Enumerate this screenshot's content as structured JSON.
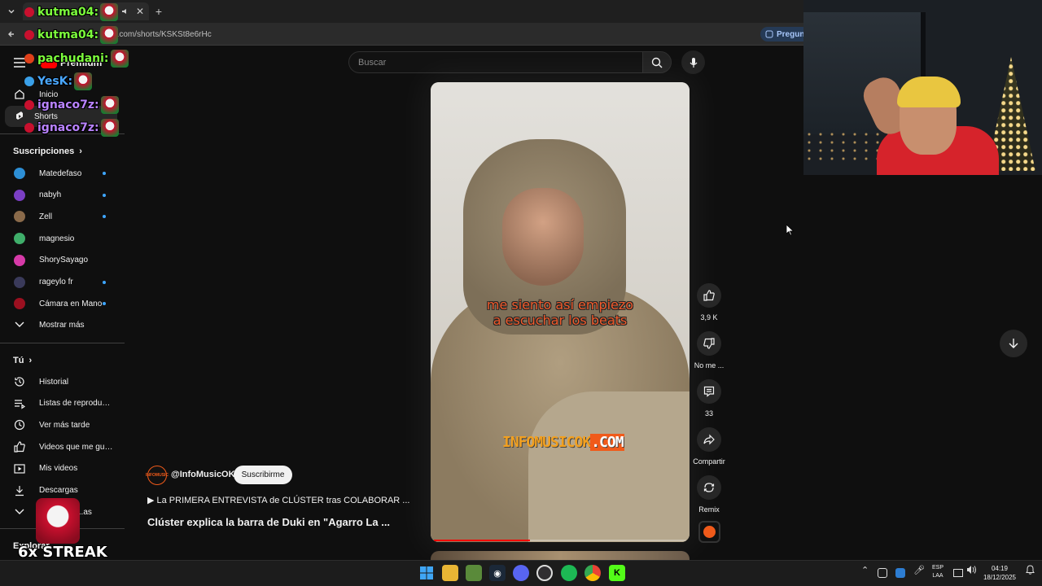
{
  "browser": {
    "tab_title": "",
    "url": "...com/shorts/KSKSt8e6rHc",
    "gemini_label": "Preguntar"
  },
  "youtube": {
    "premium_label": "Premium",
    "nav": {
      "inicio": "Inicio",
      "shorts": "Shorts"
    },
    "subscriptions_title": "Suscripciones",
    "subscriptions": [
      {
        "name": "Matedefaso",
        "color": "#2d8fd5",
        "dot": true
      },
      {
        "name": "nabyh",
        "color": "#7b3fc4",
        "dot": true
      },
      {
        "name": "Zell",
        "color": "#8a6a4a",
        "dot": true
      },
      {
        "name": "magnesio",
        "color": "#3fae6a",
        "dot": false
      },
      {
        "name": "ShorySayago",
        "color": "#d63aa8",
        "dot": false
      },
      {
        "name": "rageylo fr",
        "color": "#3a3a5a",
        "dot": true
      },
      {
        "name": "Cámara en Mano",
        "color": "#9b1020",
        "dot": true
      }
    ],
    "show_more": "Mostrar más",
    "you_title": "Tú",
    "you_items": [
      {
        "label": "Historial",
        "icon": "history-icon"
      },
      {
        "label": "Listas de reproducc...",
        "icon": "playlist-icon"
      },
      {
        "label": "Ver más tarde",
        "icon": "clock-icon"
      },
      {
        "label": "Videos que me gus...",
        "icon": "thumb-up-icon"
      },
      {
        "label": "Mis videos",
        "icon": "play-box-icon"
      },
      {
        "label": "Descargas",
        "icon": "download-icon"
      }
    ],
    "you_more_partial": "...as",
    "explore_title": "Explorar",
    "search_placeholder": "Buscar",
    "short": {
      "caption_line1": "me siento así empiezo",
      "caption_line2": "a escuchar los beats",
      "watermark_main": "INFOMUSICOK",
      "watermark_tld": ".COM",
      "progress": 0.38,
      "channel_handle": "@InfoMusicOK",
      "channel_avatar_text": "INFOMUSIC",
      "subscribe_label": "Suscribirme",
      "playlist_text": "▶  La PRIMERA ENTREVISTA de CLÚSTER tras COLABORAR ...",
      "title": "Clúster explica la barra de Duki en \"Agarro La ..."
    },
    "actions": {
      "likes": "3,9 K",
      "dislike_label": "No me ...",
      "comments": "33",
      "share_label": "Compartir",
      "remix_label": "Remix"
    }
  },
  "stream_overlay": {
    "chat": [
      {
        "user": "kutma04:",
        "color": "#7cfc3c",
        "badge": "#c8102e"
      },
      {
        "user": "kutma04:",
        "color": "#7cfc3c",
        "badge": "#c8102e"
      },
      {
        "user": "pachudani:",
        "color": "#7cfc3c",
        "badge": "#e0401a"
      },
      {
        "user": "YesK:",
        "color": "#4aa8ff",
        "badge": "#3aa0e8"
      },
      {
        "user": "ignaco7z:",
        "color": "#b983ff",
        "badge": "#c8102e"
      },
      {
        "user": "ignaco7z:",
        "color": "#b983ff",
        "badge": "#c8102e"
      }
    ],
    "streak": "6x STREAK"
  },
  "taskbar": {
    "lang_line1": "ESP",
    "lang_line2": "LAA",
    "time": "04:19",
    "date": "18/12/2025",
    "apps": [
      "windows-start-icon",
      "file-explorer-icon",
      "minecraft-icon",
      "steam-icon",
      "discord-icon",
      "obs-icon",
      "spotify-icon",
      "chrome-icon",
      "kick-icon"
    ]
  },
  "colors": {
    "youtube_bg": "#0f0f0f",
    "accent_red": "#ff0000",
    "link_blue": "#3ea6ff"
  }
}
